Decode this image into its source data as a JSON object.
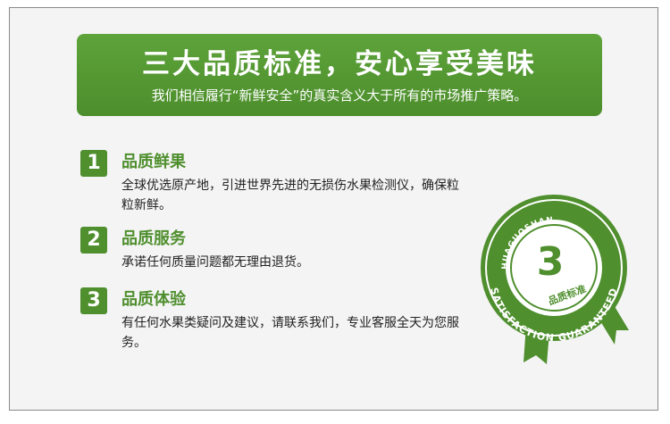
{
  "banner": {
    "title": "三大品质标准，安心享受美味",
    "subtitle": "我们相信履行“新鲜安全”的真实含义大于所有的市场推广策略。"
  },
  "items": [
    {
      "number": "1",
      "title": "品质鲜果",
      "desc": "全球优选原产地，引进世界先进的无损伤水果检测仪，确保粒粒新鲜。"
    },
    {
      "number": "2",
      "title": "品质服务",
      "desc": "承诺任何质量问题都无理由退货。"
    },
    {
      "number": "3",
      "title": "品质体验",
      "desc": "有任何水果类疑问及建议，请联系我们，专业客服全天为您服务。"
    }
  ],
  "badge": {
    "top_text": "HUAGUOSHAN",
    "number": "3",
    "label": "品质标准",
    "bottom_text": "SATISFACTION GUARANTEED",
    "color": "#4f8f2e"
  }
}
